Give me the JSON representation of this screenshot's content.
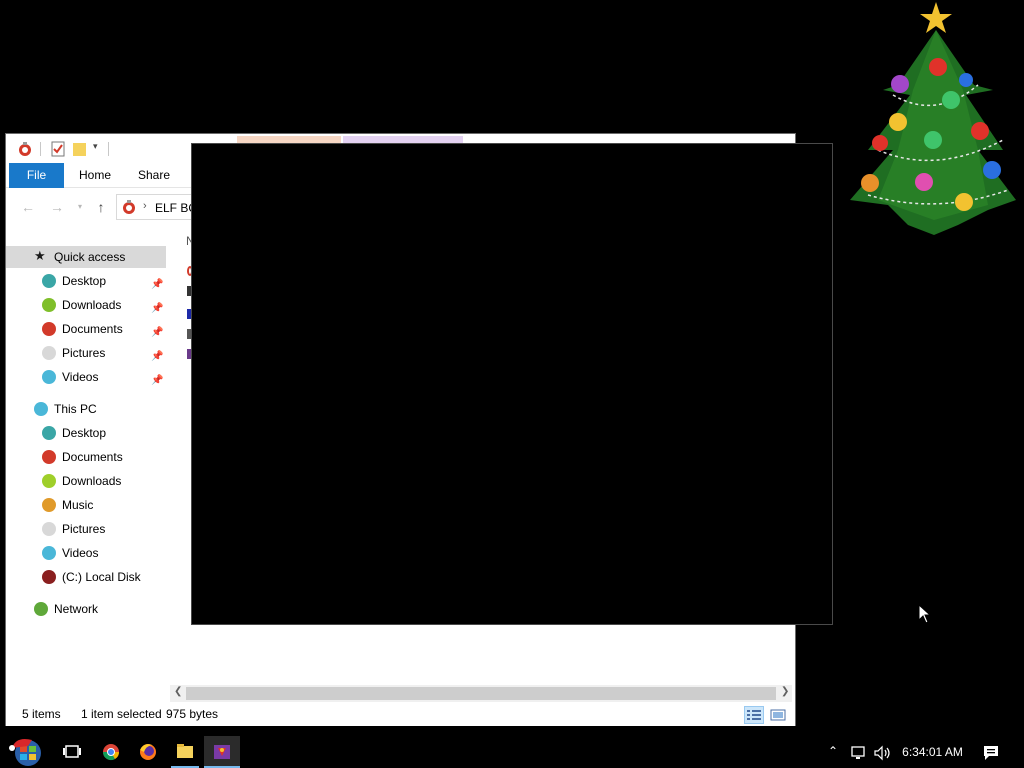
{
  "explorer": {
    "ribbon": {
      "file": "File",
      "home": "Home",
      "share": "Share"
    },
    "address": {
      "path": "ELF BO"
    },
    "column_header": "N",
    "nav": {
      "quick_access": "Quick access",
      "quick_items": [
        {
          "label": "Desktop",
          "icon": "ornament-teal",
          "color": "#3aa6a6"
        },
        {
          "label": "Downloads",
          "icon": "ornament-green",
          "color": "#7fbf2a"
        },
        {
          "label": "Documents",
          "icon": "ornament-red",
          "color": "#d23a2a"
        },
        {
          "label": "Pictures",
          "icon": "ornament-white",
          "color": "#d8d8d8"
        },
        {
          "label": "Videos",
          "icon": "ornament-cyan",
          "color": "#4ab7d8"
        }
      ],
      "this_pc": "This PC",
      "pc_items": [
        {
          "label": "Desktop",
          "icon": "ornament-teal",
          "color": "#3aa6a6"
        },
        {
          "label": "Documents",
          "icon": "ornament-red",
          "color": "#d23a2a"
        },
        {
          "label": "Downloads",
          "icon": "ornament-green",
          "color": "#9fcf2a"
        },
        {
          "label": "Music",
          "icon": "ornament-orange",
          "color": "#e09a2a"
        },
        {
          "label": "Pictures",
          "icon": "ornament-white",
          "color": "#d8d8d8"
        },
        {
          "label": "Videos",
          "icon": "ornament-cyan",
          "color": "#4ab7d8"
        },
        {
          "label": "(C:) Local Disk",
          "icon": "ornament-dark-red",
          "color": "#8a1f1f"
        }
      ],
      "network": "Network"
    },
    "status": {
      "items": "5 items",
      "selected": "1 item selected",
      "size": "975 bytes"
    }
  },
  "taskbar": {
    "time": "6:34:01 AM",
    "apps": [
      "start-button",
      "task-view",
      "chrome",
      "firefox",
      "file-explorer",
      "app-game"
    ]
  },
  "colors": {
    "accent": "#1979ca",
    "selection": "#cce6fa"
  }
}
